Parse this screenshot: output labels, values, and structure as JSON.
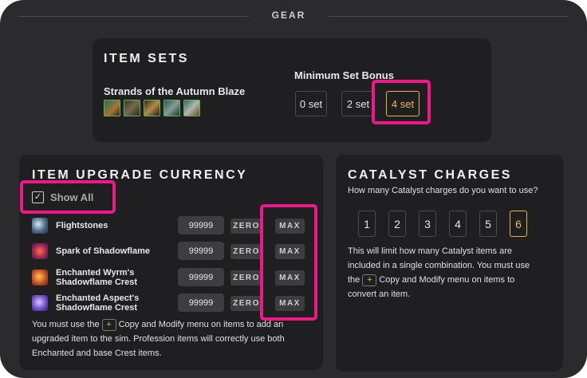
{
  "gear": {
    "title": "GEAR"
  },
  "item_sets": {
    "title": "ITEM SETS",
    "set_name": "Strands of the Autumn Blaze",
    "icons": [
      "set-piece-1-icon",
      "set-piece-2-icon",
      "set-piece-3-icon",
      "set-piece-4-icon",
      "set-piece-5-icon"
    ],
    "min_bonus_label": "Minimum Set Bonus",
    "options": [
      "0 set",
      "2 set",
      "4 set"
    ],
    "selected": "4 set"
  },
  "upgrade_currency": {
    "title": "ITEM UPGRADE CURRENCY",
    "show_all_label": "Show All",
    "show_all_checked": true,
    "rows": [
      {
        "name_line1": "Flightstones",
        "name_line2": "",
        "value": "99999",
        "zero": "ZERO",
        "max": "MAX",
        "icon": "flightstones-icon"
      },
      {
        "name_line1": "Spark of Shadowflame",
        "name_line2": "",
        "value": "99999",
        "zero": "ZERO",
        "max": "MAX",
        "icon": "spark-of-shadowflame-icon"
      },
      {
        "name_line1": "Enchanted Wyrm's",
        "name_line2": "Shadowflame Crest",
        "value": "99999",
        "zero": "ZERO",
        "max": "MAX",
        "icon": "wyrm-crest-icon"
      },
      {
        "name_line1": "Enchanted Aspect's",
        "name_line2": "Shadowflame Crest",
        "value": "99999",
        "zero": "ZERO",
        "max": "MAX",
        "icon": "aspect-crest-icon"
      }
    ],
    "note_pre": "You must use the",
    "note_plus": "+",
    "note_line1_post": "Copy and Modify menu on items to add an",
    "note_line2": "upgraded item to the sim. Profession items will correctly use both",
    "note_line3": "Enchanted and base Crest items."
  },
  "catalyst": {
    "title": "CATALYST CHARGES",
    "question": "How many Catalyst charges do you want to use?",
    "options": [
      "1",
      "2",
      "3",
      "4",
      "5",
      "6"
    ],
    "selected": "6",
    "note_line1": "This will limit how many Catalyst items are",
    "note_line2": "included in a single combination. You must use",
    "note_pre": "the",
    "note_plus": "+",
    "note_line3_post": "Copy and Modify menu on items to",
    "note_line4": "convert an item."
  },
  "colors": {
    "highlight": "#ee1889",
    "accent": "#f2b93b",
    "panel": "#1f1f21",
    "background": "#2b2b2e"
  }
}
